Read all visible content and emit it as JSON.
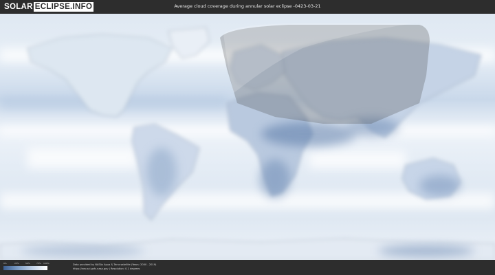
{
  "header": {
    "logo_solar": "SOLAR",
    "logo_eclipse": "ECLIPSE.INFO",
    "title": "Average cloud coverage during annular solar eclipse -0423-03-21"
  },
  "legend": {
    "ticks": [
      "0%",
      "25%",
      "50%",
      "75%",
      "100%"
    ]
  },
  "footer": {
    "credit_line1": "Data provided by NASAs Aqua & Terra satellite (Years: 2000 - 2019)",
    "credit_line2": "https://neo.sci.gsfc.nasa.gov | Resolution: 0.1 degrees"
  },
  "colors": {
    "topbar_bg": "#2d2d2d",
    "ocean_clear": "#f3f7fb",
    "cloud_dark": "#4c6a9a",
    "eclipse_shadow": "#5a5a5a"
  }
}
